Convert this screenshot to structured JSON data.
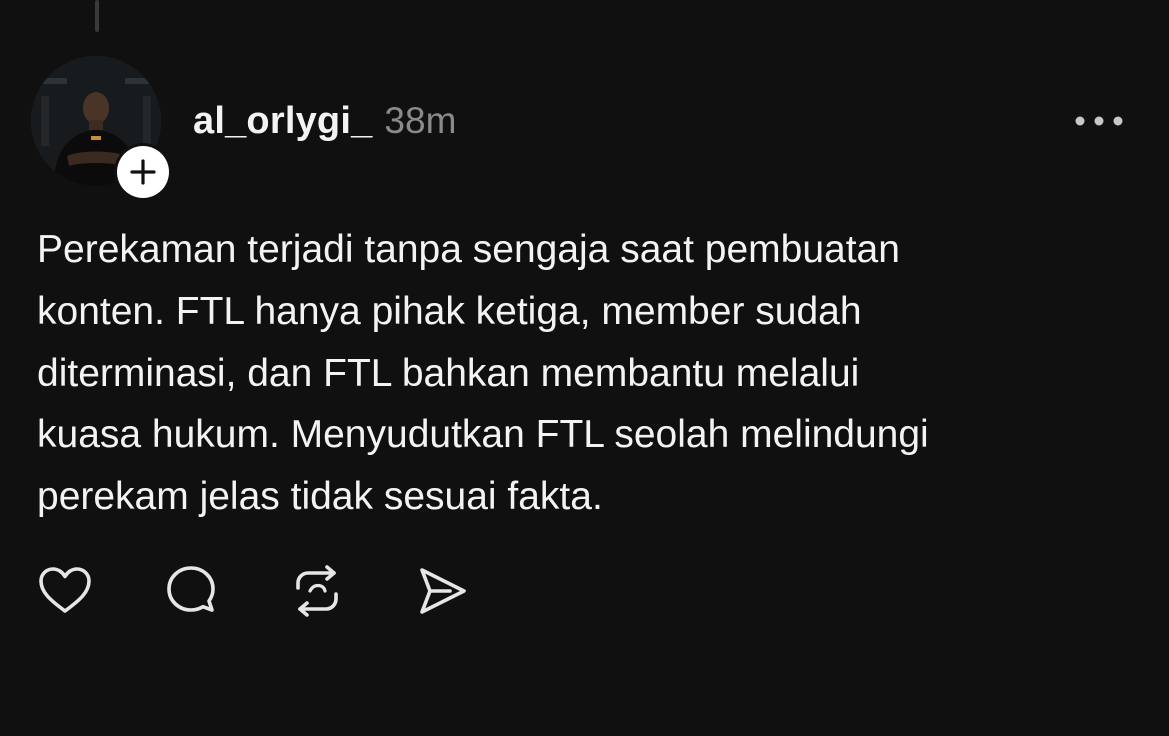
{
  "post": {
    "username": "al_orlygi_",
    "timestamp": "38m",
    "text_lines": [
      "Perekaman terjadi tanpa sengaja saat pembuatan",
      "konten. FTL hanya pihak ketiga, member sudah",
      "diterminasi, dan FTL bahkan membantu melalui",
      "kuasa hukum. Menyudutkan FTL seolah melindungi",
      "perekam jelas tidak sesuai fakta."
    ]
  },
  "icons": {
    "follow": "plus-icon",
    "menu": "more-horizontal-icon",
    "actions": [
      "heart-icon",
      "comment-icon",
      "repost-icon",
      "share-icon"
    ]
  },
  "colors": {
    "background": "#101010",
    "text": "#f3f3f3",
    "muted": "#8a8a8a",
    "badge": "#ffffff"
  }
}
